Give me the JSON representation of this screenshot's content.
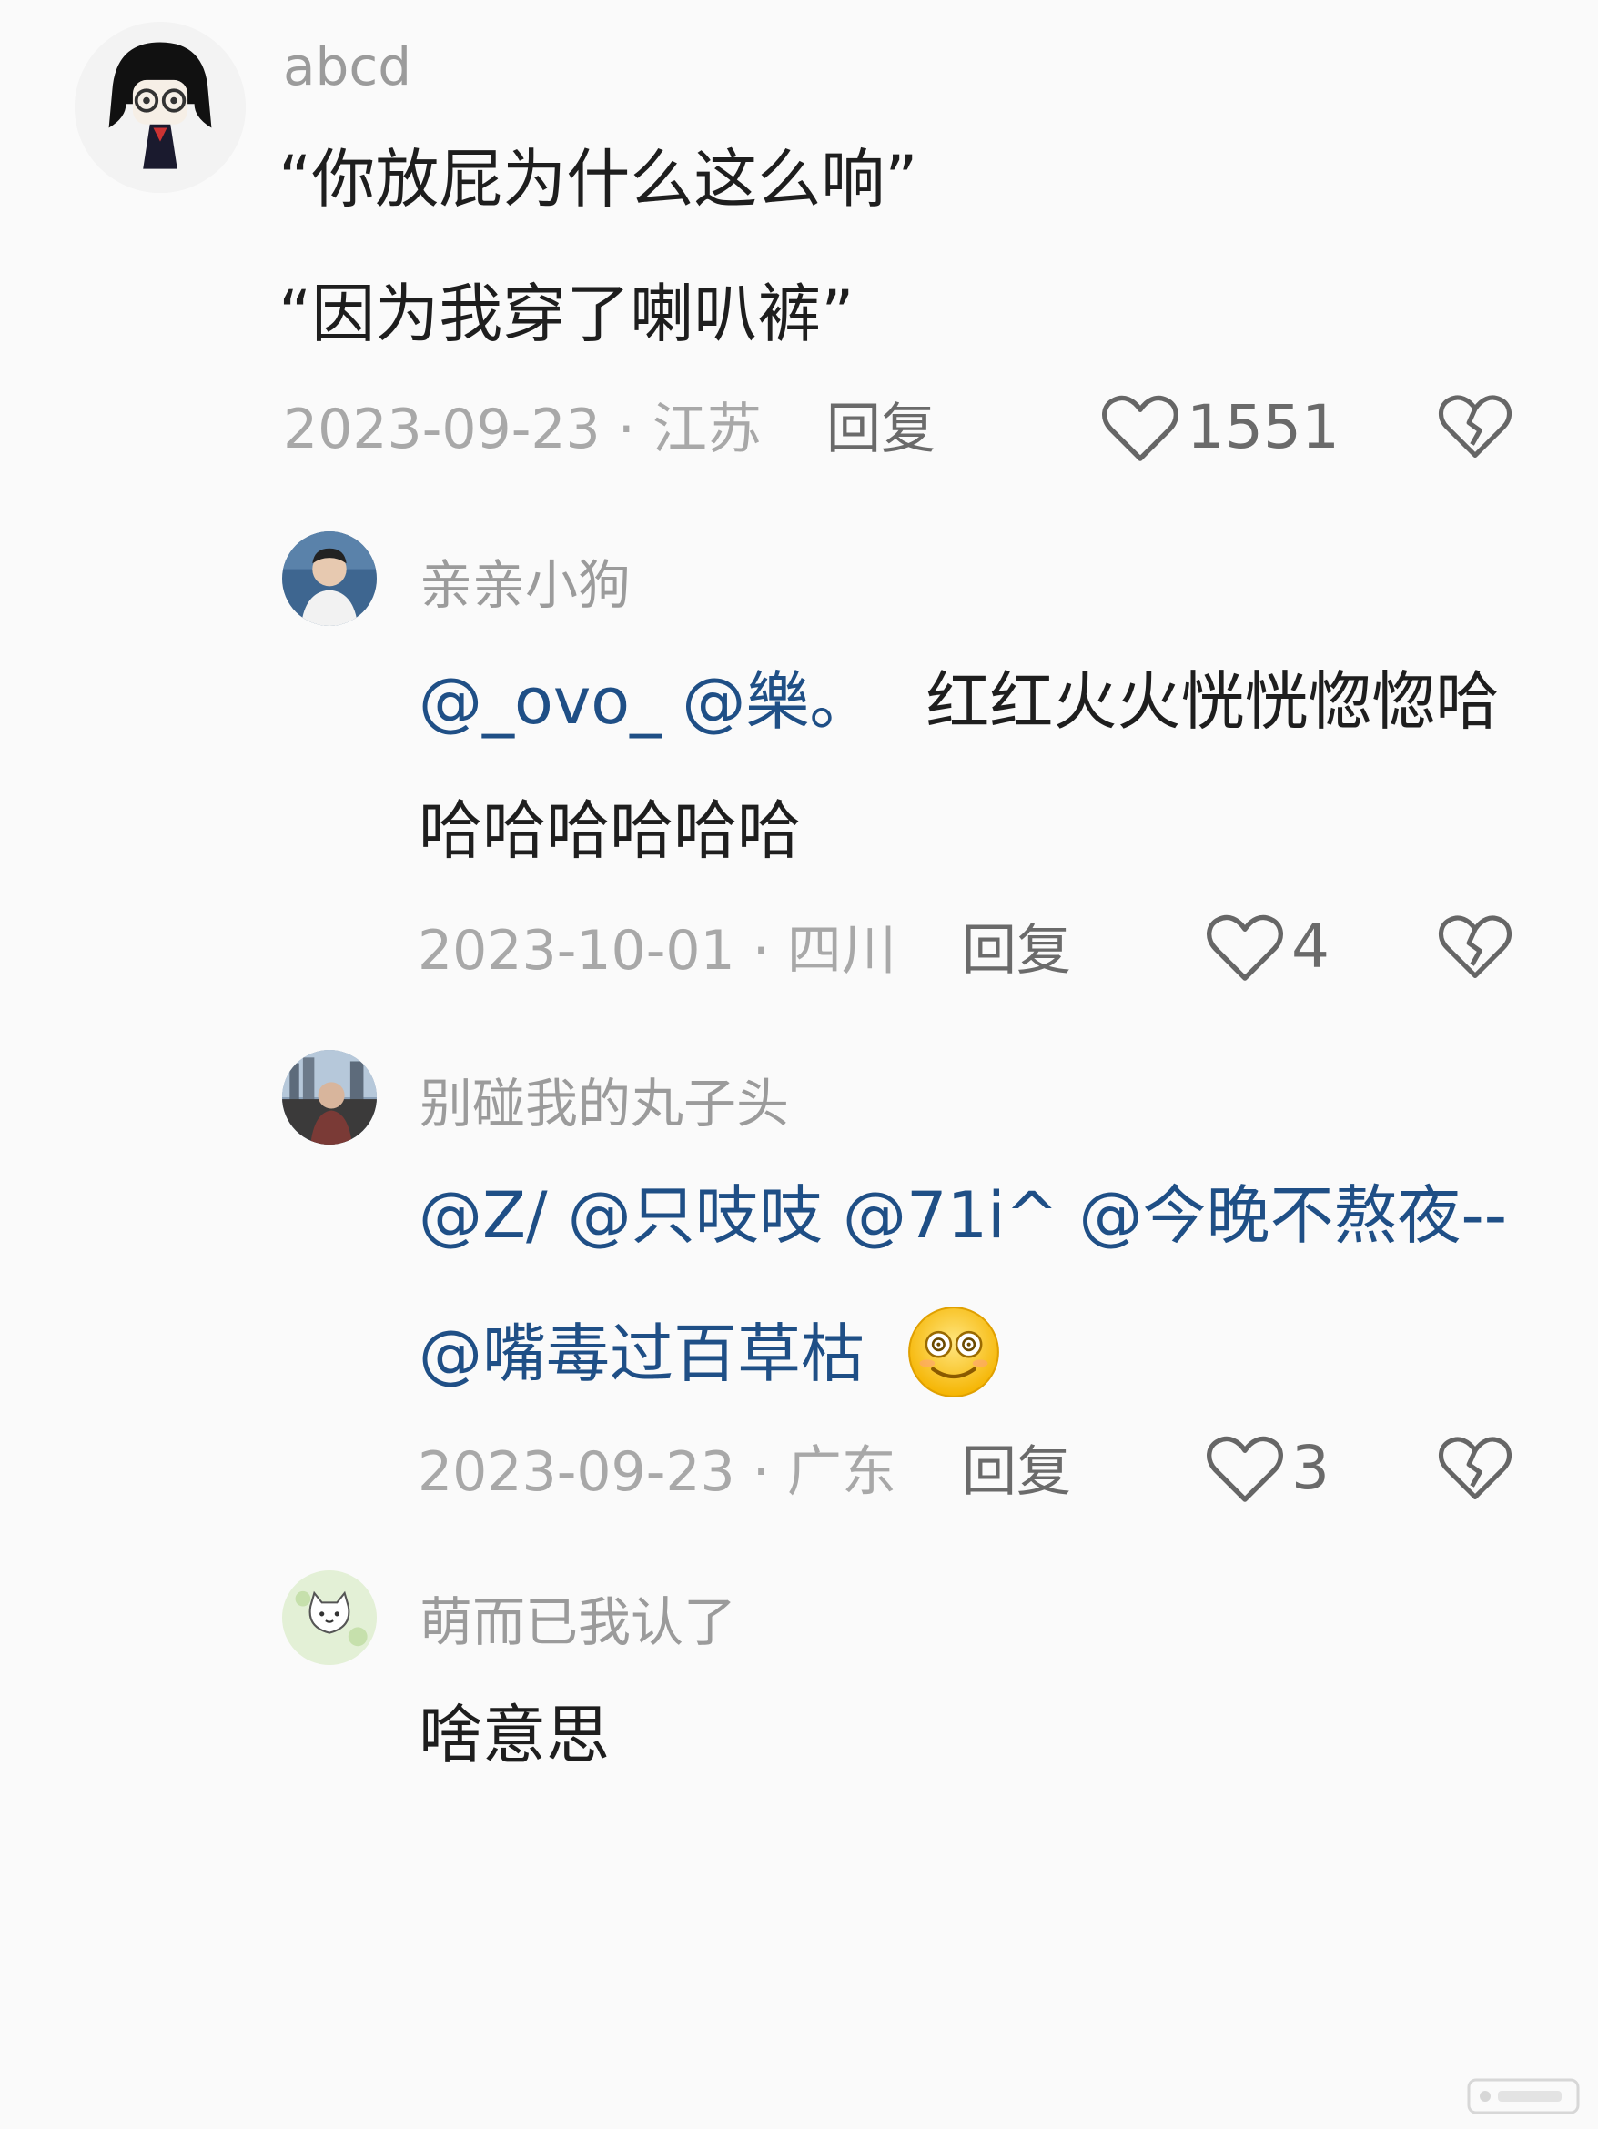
{
  "comments": [
    {
      "username": "abcd",
      "lines": [
        "“你放屁为什么这么响”",
        "“因为我穿了喇叭裤”"
      ],
      "meta": "2023-09-23 · 江苏",
      "reply_label": "回复",
      "likes": "1551"
    },
    {
      "username": "亲亲小狗",
      "line1_mentions": "@_ovo_ @樂。",
      "line1_text": "红红火火恍恍惚惚哈",
      "line2_text": "哈哈哈哈哈哈",
      "meta": "2023-10-01 · 四川",
      "reply_label": "回复",
      "likes": "4"
    },
    {
      "username": "别碰我的丸子头",
      "line1_mentions": "@Z/ @只吱吱 @71i^ @今晚不熬夜--",
      "line2_mentions": "@嘴毒过百草枯",
      "emoji": "smiling-face-emoji",
      "meta": "2023-09-23 · 广东",
      "reply_label": "回复",
      "likes": "3"
    },
    {
      "username": "萌而已我认了",
      "line1_text": "啥意思"
    }
  ],
  "icons": {
    "like": "heart-outline-icon",
    "dislike": "broken-heart-icon"
  },
  "colors": {
    "mention": "#1f4f86",
    "meta": "#a8a8a8",
    "background": "#fafafa"
  }
}
